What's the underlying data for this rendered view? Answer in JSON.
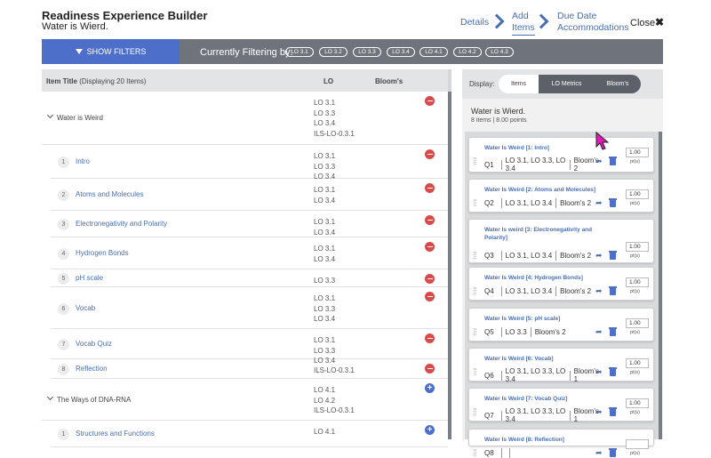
{
  "header": {
    "title": "Readiness Experience Builder",
    "subtitle": "Water is Wierd.",
    "steps": [
      "Details",
      "Add Items",
      "Due Date Accommodations"
    ],
    "close": "Close",
    "close_icon": "✖"
  },
  "filter": {
    "show_filters": "SHOW FILTERS",
    "current_label": "Currently Filtering by:",
    "chips": [
      "LO 3.1",
      "LO 3.2",
      "LO 3.3",
      "LO 3.4",
      "LO 4.1",
      "LO 4.2",
      "LO 4.3"
    ]
  },
  "table": {
    "col_title": "Item Title",
    "col_title_note": "(Displaying 20 Items)",
    "col_lo": "LO",
    "col_bloom": "Bloom's"
  },
  "rows": [
    {
      "type": "group",
      "title": "Water is Weird",
      "lo": [
        "LO 3.1",
        "LO 3.3",
        "LO 3.4",
        "ILS-LO-0.3.1"
      ],
      "action": "remove"
    },
    {
      "type": "item",
      "num": "1",
      "title": "Intro",
      "lo": [
        "LO 3.1",
        "LO 3.3",
        "LO 3.4"
      ],
      "action": "remove"
    },
    {
      "type": "item",
      "num": "2",
      "title": "Atoms and Molecules",
      "lo": [
        "LO 3.1",
        "LO 3.4"
      ],
      "action": "remove"
    },
    {
      "type": "item",
      "num": "3",
      "title": "Electronegativity and Polarity",
      "lo": [
        "LO 3.1",
        "LO 3.4"
      ],
      "action": "remove"
    },
    {
      "type": "item",
      "num": "4",
      "title": "Hydrogen Bonds",
      "lo": [
        "LO 3.1",
        "LO 3.4"
      ],
      "action": "remove"
    },
    {
      "type": "item",
      "num": "5",
      "title": "pH scale",
      "lo": [
        "LO 3.3"
      ],
      "action": "remove"
    },
    {
      "type": "item",
      "num": "6",
      "title": "Vocab",
      "lo": [
        "LO 3.1",
        "LO 3.3",
        "LO 3.4"
      ],
      "action": "remove"
    },
    {
      "type": "item",
      "num": "7",
      "title": "Vocab Quiz",
      "lo": [
        "LO 3.1",
        "LO 3.3",
        "LO 3.4"
      ],
      "action": "remove"
    },
    {
      "type": "item",
      "num": "8",
      "title": "Reflection",
      "lo": [
        "ILS-LO-0.3.1"
      ],
      "action": "remove"
    },
    {
      "type": "group",
      "title": "The Ways of DNA-RNA",
      "lo": [
        "LO 4.1",
        "LO 4.2",
        "ILS-LO-0.3.1"
      ],
      "action": "add"
    },
    {
      "type": "item",
      "num": "1",
      "title": "Structures and Functions",
      "lo": [
        "LO 4.1"
      ],
      "action": "add"
    }
  ],
  "display": {
    "label": "Display:",
    "tabs": [
      "Items",
      "LO Metrics",
      "Bloom's"
    ],
    "selected": "Items"
  },
  "set": {
    "title": "Water is Wierd.",
    "meta": "8 items | 8.00 points"
  },
  "cards": [
    {
      "title": "Water Is Weird [1: Intro]",
      "q": "Q1",
      "lo": "LO 3.1, LO 3.3, LO 3.4",
      "bloom": "Bloom's 2",
      "pts": "1.00"
    },
    {
      "title": "Water Is Weird [2: Atoms and Molecules]",
      "q": "Q2",
      "lo": "LO 3.1, LO 3.4",
      "bloom": "Bloom's 2",
      "pts": "1.00"
    },
    {
      "title": "Water Is weird [3: Electronegativity and Polarity]",
      "q": "Q3",
      "lo": "LO 3.1, LO 3.4",
      "bloom": "Bloom's 2",
      "pts": "1.00"
    },
    {
      "title": "Water Is Weird [4: Hydrogen Bonds]",
      "q": "Q4",
      "lo": "LO 3.1, LO 3.4",
      "bloom": "Bloom's 2",
      "pts": "1.00"
    },
    {
      "title": "Water Is Weird [5: pH scale]",
      "q": "Q5",
      "lo": "LO 3.3",
      "bloom": "Bloom's 2",
      "pts": "1.00"
    },
    {
      "title": "Water Is Weird [6: Vocab]",
      "q": "Q6",
      "lo": "LO 3.1, LO 3.3, LO 3.4",
      "bloom": "Bloom's 1",
      "pts": "1.00"
    },
    {
      "title": "Water Is Weird [7: Vocab Quiz]",
      "q": "Q7",
      "lo": "LO 3.1, LO 3.3, LO 3.4",
      "bloom": "Bloom's 1",
      "pts": "1.00"
    },
    {
      "title": "Water Is Weird [8: Reflection]",
      "q": "Q8",
      "lo": "",
      "bloom": "",
      "pts": ""
    }
  ],
  "pt_unit": "pt(s)",
  "colors": {
    "accent": "#4d6fc9",
    "remove": "#d84b4b",
    "filterbar": "#6f747c"
  }
}
